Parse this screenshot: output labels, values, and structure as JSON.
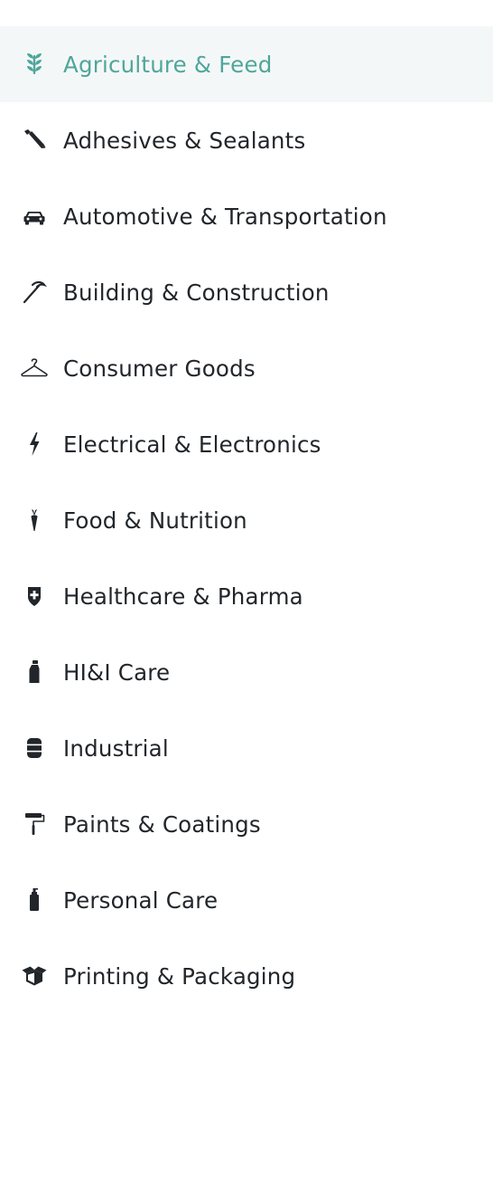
{
  "menu": {
    "active_color": "#4fa69a",
    "text_color": "#22262a",
    "active_background": "#f4f7f8",
    "items": [
      {
        "label": "Agriculture & Feed",
        "icon": "wheat-icon",
        "active": true
      },
      {
        "label": "Adhesives & Sealants",
        "icon": "glue-stick-icon",
        "active": false
      },
      {
        "label": "Automotive & Transportation",
        "icon": "car-icon",
        "active": false
      },
      {
        "label": "Building & Construction",
        "icon": "hammer-icon",
        "active": false
      },
      {
        "label": "Consumer Goods",
        "icon": "hanger-icon",
        "active": false
      },
      {
        "label": "Electrical & Electronics",
        "icon": "lightning-icon",
        "active": false
      },
      {
        "label": "Food & Nutrition",
        "icon": "carrot-icon",
        "active": false
      },
      {
        "label": "Healthcare & Pharma",
        "icon": "medical-shield-icon",
        "active": false
      },
      {
        "label": "HI&I Care",
        "icon": "spray-bottle-icon",
        "active": false
      },
      {
        "label": "Industrial",
        "icon": "barrel-icon",
        "active": false
      },
      {
        "label": "Paints & Coatings",
        "icon": "paint-roller-icon",
        "active": false
      },
      {
        "label": "Personal Care",
        "icon": "pump-bottle-icon",
        "active": false
      },
      {
        "label": "Printing & Packaging",
        "icon": "open-box-icon",
        "active": false
      }
    ]
  }
}
